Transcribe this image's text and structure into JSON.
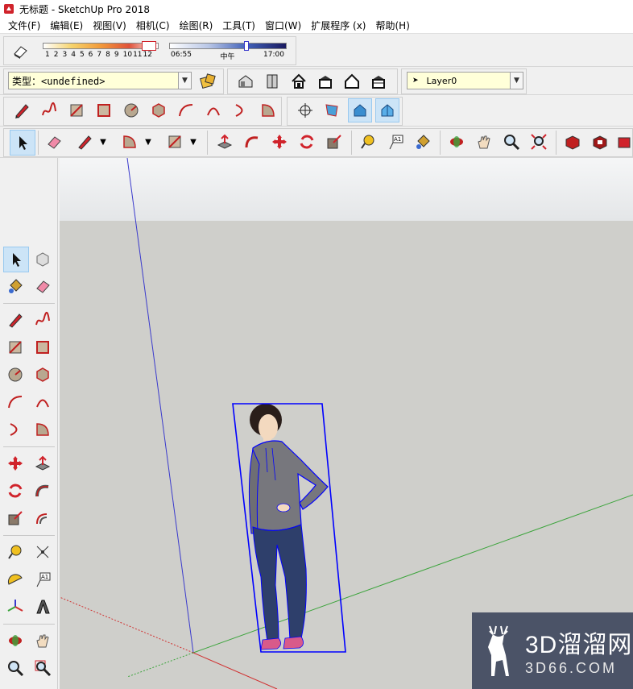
{
  "window": {
    "title": "无标题 - SketchUp Pro 2018"
  },
  "menu": [
    "文件(F)",
    "编辑(E)",
    "视图(V)",
    "相机(C)",
    "绘图(R)",
    "工具(T)",
    "窗口(W)",
    "扩展程序 (x)",
    "帮助(H)"
  ],
  "shadows": {
    "month_scale": [
      "1",
      "2",
      "3",
      "4",
      "5",
      "6",
      "7",
      "8",
      "9",
      "10",
      "11",
      "12"
    ],
    "time_start": "06:55",
    "time_mid": "中午",
    "time_end": "17:00"
  },
  "entity": {
    "type_value": "类型：<undefined>"
  },
  "layers": {
    "current": "Layer0"
  },
  "watermark": {
    "main": "3D溜溜网",
    "sub": "3D66.COM"
  },
  "colors": {
    "accent_red": "#d0232b",
    "selection_blue": "#0000ff",
    "axis_blue": "#3a3acc",
    "axis_green": "#3ca43c",
    "axis_red": "#d03030"
  }
}
